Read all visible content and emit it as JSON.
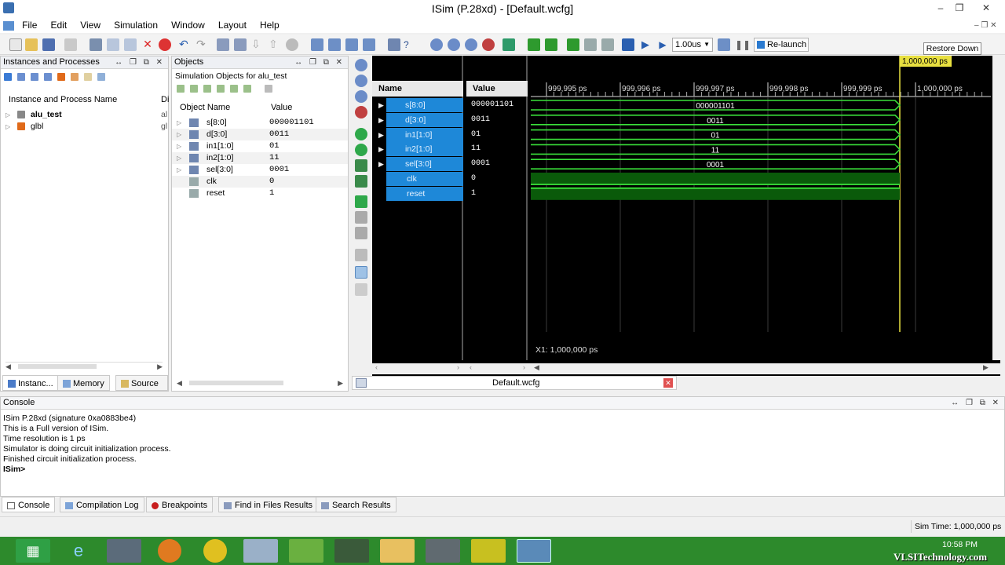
{
  "window": {
    "title": "ISim (P.28xd) - [Default.wcfg]",
    "tooltip": "Restore Down"
  },
  "menu": [
    "File",
    "Edit",
    "View",
    "Simulation",
    "Window",
    "Layout",
    "Help"
  ],
  "toolbar": {
    "time_step": "1.00us",
    "relaunch": "Re-launch"
  },
  "instances": {
    "title": "Instances and Processes",
    "column": "Instance and Process Name",
    "col2": "Di",
    "rows": [
      {
        "name": "alu_test",
        "v": "al"
      },
      {
        "name": "glbl",
        "v": "gl"
      }
    ],
    "tabs": [
      "Instanc...",
      "Memory",
      "Source ..."
    ]
  },
  "objects": {
    "title": "Objects",
    "subtitle": "Simulation Objects for alu_test",
    "col_name": "Object Name",
    "col_value": "Value",
    "rows": [
      {
        "name": "s[8:0]",
        "value": "000001101"
      },
      {
        "name": "d[3:0]",
        "value": "0011"
      },
      {
        "name": "in1[1:0]",
        "value": "01"
      },
      {
        "name": "in2[1:0]",
        "value": "11"
      },
      {
        "name": "sel[3:0]",
        "value": "0001"
      },
      {
        "name": "clk",
        "value": "0"
      },
      {
        "name": "reset",
        "value": "1"
      }
    ]
  },
  "wave": {
    "col_name": "Name",
    "col_value": "Value",
    "cursor_label": "1,000,000 ps",
    "ticks": [
      "999,995 ps",
      "999,996 ps",
      "999,997 ps",
      "999,998 ps",
      "999,999 ps",
      "1,000,000 ps"
    ],
    "signals": [
      {
        "name": "s[8:0]",
        "value": "000001101",
        "bus": "000001101"
      },
      {
        "name": "d[3:0]",
        "value": "0011",
        "bus": "0011"
      },
      {
        "name": "in1[1:0]",
        "value": "01",
        "bus": "01"
      },
      {
        "name": "in2[1:0]",
        "value": "11",
        "bus": "11"
      },
      {
        "name": "sel[3:0]",
        "value": "0001",
        "bus": "0001"
      },
      {
        "name": "clk",
        "value": "0",
        "bus": ""
      },
      {
        "name": "reset",
        "value": "1",
        "bus": ""
      }
    ],
    "x1": "X1: 1,000,000 ps",
    "tab": "Default.wcfg"
  },
  "console": {
    "title": "Console",
    "lines": [
      "ISim P.28xd (signature 0xa0883be4)",
      "This is a Full version of ISim.",
      "Time resolution is 1 ps",
      "Simulator is doing circuit initialization process.",
      "Finished circuit initialization process."
    ],
    "prompt": "ISim>",
    "tabs": [
      "Console",
      "Compilation Log",
      "Breakpoints",
      "Find in Files Results",
      "Search Results"
    ]
  },
  "status": {
    "sim_time": "Sim Time: 1,000,000 ps"
  },
  "taskbar": {
    "time": "10:58 PM",
    "watermark": "VLSITechnology.com"
  }
}
